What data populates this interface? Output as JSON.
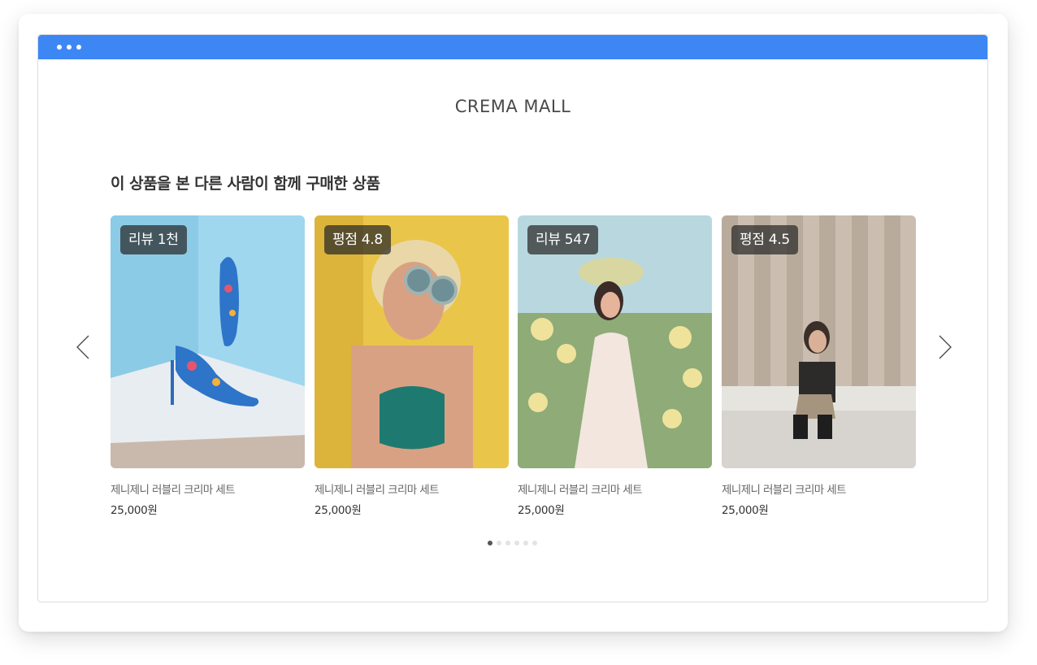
{
  "window": {
    "accent_color": "#3d87f5"
  },
  "header": {
    "mall_title": "CREMA MALL"
  },
  "section": {
    "title": "이 상품을 본 다른 사람이 함께 구매한 상품"
  },
  "carousel": {
    "prev_icon": "chevron-left-icon",
    "next_icon": "chevron-right-icon",
    "products": [
      {
        "badge": "리뷰 1천",
        "name": "제니제니 러블리 크리마 세트",
        "price": "25,000원",
        "image": "blue-floral-heels-photo"
      },
      {
        "badge": "평점 4.8",
        "name": "제니제니 러블리 크리마 세트",
        "price": "25,000원",
        "image": "woman-round-sunglasses-yellow-wall-photo"
      },
      {
        "badge": "리뷰 547",
        "name": "제니제니 러블리 크리마 세트",
        "price": "25,000원",
        "image": "woman-flower-field-photo"
      },
      {
        "badge": "평점 4.5",
        "name": "제니제니 러블리 크리마 세트",
        "price": "25,000원",
        "image": "woman-crouching-curtain-photo"
      }
    ],
    "pagination": {
      "total": 6,
      "active": 1
    }
  }
}
